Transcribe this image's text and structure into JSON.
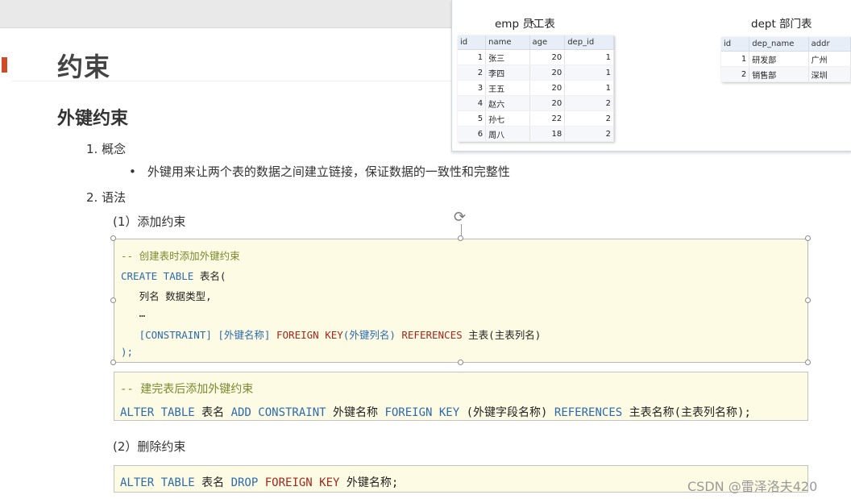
{
  "slide": {
    "title": "约束",
    "subtitle": "外键约束",
    "item1": "1. 概念",
    "bullet_symbol": "•",
    "bullet": "外键用来让两个表的数据之间建立链接，保证数据的一致性和完整性",
    "item2": "2. 语法",
    "step1": "(1）添加约束",
    "step2": "(2）删除约束"
  },
  "code_block1": {
    "comment": "-- 创建表时添加外键约束",
    "l2_kw": "CREATE TABLE",
    "l2_tx": " 表名(",
    "l3": "   列名 数据类型,",
    "l4": "   …",
    "l5_a": "   [CONSTRAINT] [外键名称] ",
    "l5_fk": "FOREIGN KEY",
    "l5_b": "(外键列名) ",
    "l5_kw": "REFERENCES",
    "l5_c": " 主表(主表列名)",
    "l6": ");"
  },
  "code_block2": {
    "comment": "-- 建完表后添加外键约束",
    "kw1": "ALTER TABLE",
    "t1": " 表名 ",
    "kw2": "ADD CONSTRAINT",
    "t2": " 外键名称 ",
    "kw3": "FOREIGN KEY",
    "t3": " (外键字段名称) ",
    "kw4": "REFERENCES",
    "t4": " 主表名称(主表列名称);"
  },
  "code_block3": {
    "kw1": "ALTER TABLE",
    "t1": " 表名 ",
    "kw2": "DROP",
    "t2": " ",
    "fk": "FOREIGN KEY",
    "t3": " 外键名称;"
  },
  "emp_table": {
    "caption": "emp 员工表",
    "columns": [
      "id",
      "name",
      "age",
      "dep_id"
    ],
    "rows": [
      [
        "1",
        "张三",
        "20",
        "1"
      ],
      [
        "2",
        "李四",
        "20",
        "1"
      ],
      [
        "3",
        "王五",
        "20",
        "1"
      ],
      [
        "4",
        "赵六",
        "20",
        "2"
      ],
      [
        "5",
        "孙七",
        "22",
        "2"
      ],
      [
        "6",
        "周八",
        "18",
        "2"
      ]
    ]
  },
  "dept_table": {
    "caption": "dept 部门表",
    "columns": [
      "id",
      "dep_name",
      "addr"
    ],
    "rows": [
      [
        "1",
        "研发部",
        "广州"
      ],
      [
        "2",
        "销售部",
        "深圳"
      ]
    ]
  },
  "watermark": "CSDN @雷泽洛夫420",
  "colors": {
    "keyword": "#2a6bb0",
    "foreign_key": "#a3271f",
    "comment": "#7a8a30",
    "code_bg": "#fdfbe3",
    "title_marker": "#d04a2a"
  }
}
